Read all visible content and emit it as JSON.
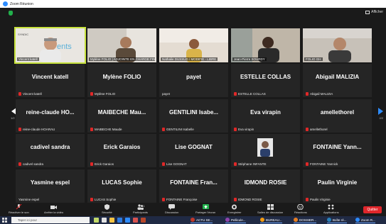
{
  "window": {
    "title": "Zoom Réunion"
  },
  "header": {
    "view_label": "Afficher"
  },
  "nav": {
    "page_left": "1/2",
    "page_right": "2/2"
  },
  "video_tiles": [
    {
      "label": "Vincent katell"
    },
    {
      "label": "Mylène FOLIO | ADJOINTE EN CHARGE FINANCES"
    },
    {
      "label": "Nathalie DUSSUD / MODIFIE - LIBRE"
    },
    {
      "label": "Jean-Pierre SOURDY"
    },
    {
      "label": "FOLIO GH"
    }
  ],
  "logo_text": "SYNDICAT ... ements",
  "tiles": [
    {
      "name": "Vincent katell",
      "label": "Vincent katell",
      "muted": true
    },
    {
      "name": "Mylène FOLIO",
      "label": "Mylène FOLIO",
      "muted": true
    },
    {
      "name": "payet",
      "label": "payet",
      "muted": false
    },
    {
      "name": "ESTELLE COLLAS",
      "label": "ESTELLE COLLAS",
      "muted": true
    },
    {
      "name": "Abigail MALIZIA",
      "label": "Abigail MALIZIA",
      "muted": true
    },
    {
      "name": "reine-claude HO...",
      "label": "reine-claude HOARAU",
      "muted": true
    },
    {
      "name": "MAIBECHE Mau...",
      "label": "MAIBECHE Maude",
      "muted": true
    },
    {
      "name": "GENTILINI Isabe...",
      "label": "GENTILINI Isabelle",
      "muted": true
    },
    {
      "name": "Eva virapin",
      "label": "Eva virapin",
      "muted": true
    },
    {
      "name": "amellethorel",
      "label": "amellethorel",
      "muted": true
    },
    {
      "name": "cadivel sandra",
      "label": "cadivel sandra",
      "muted": true
    },
    {
      "name": "Erick Garaios",
      "label": "Erick Garaios",
      "muted": true
    },
    {
      "name": "Lise GOGNAT",
      "label": "Lise GOGNAT",
      "muted": true
    },
    {
      "name": "",
      "label": "Stéphane INFANTE",
      "muted": true,
      "has_photo": true
    },
    {
      "name": "FONTAINE Yann...",
      "label": "FONTAINE Yannick",
      "muted": true
    },
    {
      "name": "Yasmine espel",
      "label": "Yasmine espel",
      "muted": false
    },
    {
      "name": "LUCAS Sophie",
      "label": "LUCAS Sophie",
      "muted": true
    },
    {
      "name": "FONTAINE Fran...",
      "label": "FONTAINE Françoise",
      "muted": true
    },
    {
      "name": "IDMOND ROSIE",
      "label": "IDMOND ROSIE",
      "muted": true
    },
    {
      "name": "Paulin Virginie",
      "label": "Paulin Virginie",
      "muted": true
    }
  ],
  "toolbar": {
    "items": [
      {
        "label": "Réactiver le son",
        "icon": "mic-muted-icon"
      },
      {
        "label": "Arrêter la vidéo",
        "icon": "camera-icon"
      },
      {
        "label": "Sécurité",
        "icon": "shield-icon"
      },
      {
        "label": "Participants",
        "icon": "participants-icon",
        "count": "51"
      },
      {
        "label": "Discussion",
        "icon": "chat-icon"
      },
      {
        "label": "Partager l'écran",
        "icon": "share-screen-icon"
      },
      {
        "label": "Enregistrer",
        "icon": "record-icon"
      },
      {
        "label": "Salles de discussion",
        "icon": "breakout-icon"
      },
      {
        "label": "Réactions",
        "icon": "reactions-icon"
      },
      {
        "label": "Applications",
        "icon": "apps-icon"
      }
    ],
    "end_label": "Quitter"
  },
  "taskbar": {
    "search_placeholder": "Taper ici pour",
    "apps": [
      {
        "label": "ACTU SE...",
        "color": "#c0392b"
      },
      {
        "label": "Pellicule...",
        "color": "#8e44ad"
      },
      {
        "label": "BUREAU...",
        "color": "#f39c12"
      },
      {
        "label": "DOSSIER...",
        "color": "#e67e22"
      },
      {
        "label": "Boîte ré...",
        "color": "#2980b9"
      },
      {
        "label": "Zoom R...",
        "color": "#2d8cff"
      }
    ]
  },
  "colors": {
    "accent": "#2d8cff",
    "muted_red": "#e02828",
    "end_red": "#e0262b",
    "active_speaker": "#c7e23c"
  }
}
